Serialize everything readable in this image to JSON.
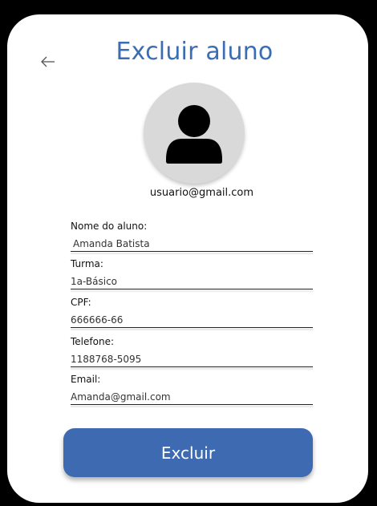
{
  "header": {
    "title": "Excluir aluno",
    "back_icon": "arrow-left-icon"
  },
  "profile": {
    "avatar_icon": "user-silhouette-icon",
    "email": "usuario@gmail.com"
  },
  "form": {
    "fields": [
      {
        "label": "Nome do aluno:",
        "value": "Amanda Batista"
      },
      {
        "label": "Turma:",
        "value": "1a-Básico"
      },
      {
        "label": "CPF:",
        "value": "666666-66"
      },
      {
        "label": "Telefone:",
        "value": "1188768-5095"
      },
      {
        "label": "Email:",
        "value": "Amanda@gmail.com"
      }
    ]
  },
  "actions": {
    "delete_label": "Excluir"
  },
  "colors": {
    "accent": "#3d6ab0",
    "title": "#3a6db4",
    "avatar_bg": "#d9d9d9"
  }
}
